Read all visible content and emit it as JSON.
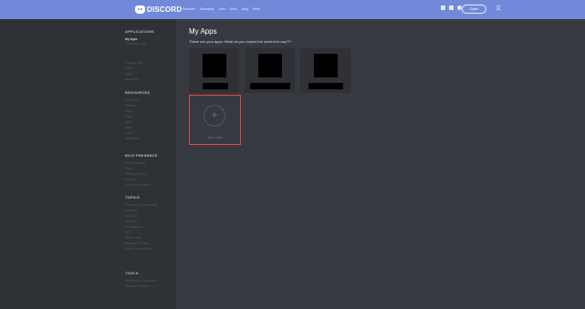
{
  "header": {
    "brand": "DISCORD",
    "nav": [
      "Features",
      "Download",
      "Jobs",
      "Docs",
      "Blog",
      "Store"
    ],
    "open_button": "Open",
    "social_icons": [
      "twitter-icon",
      "facebook-icon",
      "instagram-icon"
    ],
    "language_icon": "translate-icon"
  },
  "sidebar": {
    "applications": {
      "title": "APPLICATIONS",
      "items": [
        "My Apps",
        "Publisher Apps",
        "Change Log",
        "Intro",
        "Logo",
        "Welcome"
      ]
    },
    "resources": {
      "title": "RESOURCES",
      "items": [
        "Audit Log",
        "Channel",
        "Emoji",
        "Guild",
        "Invite",
        "User",
        "Voice",
        "Webhook"
      ]
    },
    "rich_presence": {
      "title": "RICH PRESENCE",
      "items": [
        "Best Practices",
        "FAQ",
        "Getting Started",
        "How To",
        "Launch Checklist"
      ]
    },
    "topics": {
      "title": "TOPICS",
      "items": [
        "Community Resources",
        "Gateway",
        "OAuth2",
        "Opcodes",
        "Permissions",
        "RPC",
        "Rate Limits",
        "Response Codes",
        "Voice Connections"
      ]
    },
    "tools": {
      "title": "TOOLS",
      "items": [
        "Permission Calculator",
        "Embed Visualizer"
      ]
    }
  },
  "main": {
    "title": "My Apps",
    "subtitle": "These are your apps. What do you expect the subtext to say?!?",
    "new_app_label": "New App",
    "new_app_icon": "+"
  },
  "colors": {
    "blurple": "#7289da",
    "highlight": "#e2483f"
  }
}
